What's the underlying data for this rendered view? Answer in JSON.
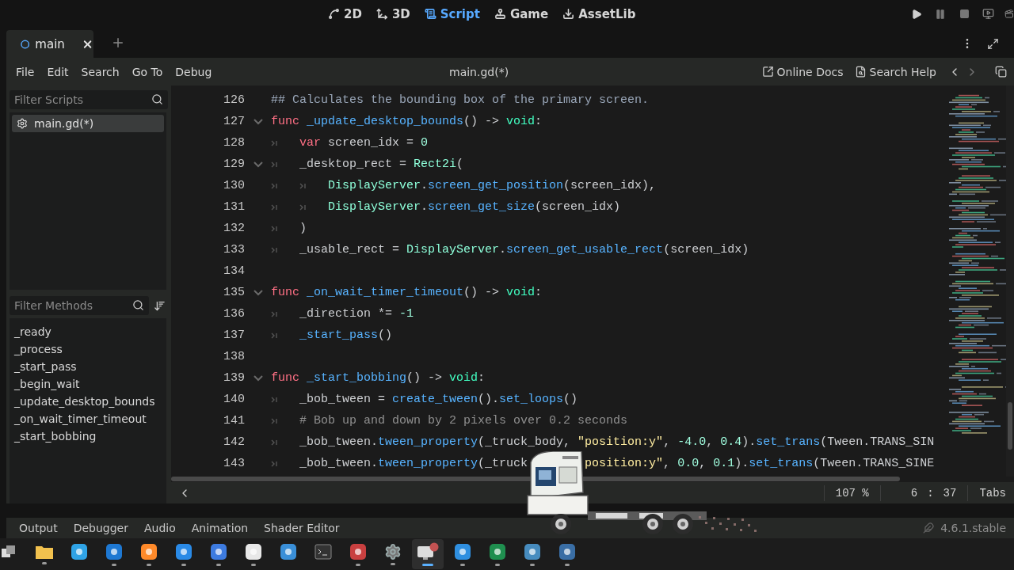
{
  "workspaces": [
    {
      "label": "2D",
      "kind": "planar",
      "selected": false
    },
    {
      "label": "3D",
      "kind": "spatial",
      "selected": false
    },
    {
      "label": "Script",
      "kind": "script",
      "selected": true
    },
    {
      "label": "Game",
      "kind": "game",
      "selected": false
    },
    {
      "label": "AssetLib",
      "kind": "assetlib",
      "selected": false
    }
  ],
  "scene_tabs": [
    {
      "label": "main",
      "selected": true
    }
  ],
  "menu": [
    "File",
    "Edit",
    "Search",
    "Go To",
    "Debug"
  ],
  "file_title": "main.gd(*)",
  "help_links": [
    {
      "label": "Online Docs",
      "kind": "docs"
    },
    {
      "label": "Search Help",
      "kind": "help"
    }
  ],
  "scripts_filter": {
    "placeholder": "Filter Scripts"
  },
  "scripts": [
    {
      "label": "main.gd(*)",
      "selected": true
    }
  ],
  "methods_filter": {
    "placeholder": "Filter Methods"
  },
  "methods": [
    "_ready",
    "_process",
    "_start_pass",
    "_begin_wait",
    "_update_desktop_bounds",
    "_on_wait_timer_timeout",
    "_start_bobbing"
  ],
  "code_lines": [
    {
      "number": "126",
      "foldable": false,
      "tokens": [
        {
          "kind": "doc",
          "text": "## Calculates the bounding box of the primary screen."
        }
      ]
    },
    {
      "number": "127",
      "foldable": true,
      "tokens": [
        {
          "kind": "keyword",
          "text": "func"
        },
        {
          "kind": "function",
          "text": "_update_desktop_bounds"
        },
        {
          "kind": "plain",
          "text": "() -> "
        },
        {
          "kind": "type",
          "text": "void"
        },
        {
          "kind": "plain",
          "text": ":"
        }
      ]
    },
    {
      "number": "128",
      "foldable": false,
      "tokens": [
        {
          "kind": "tab"
        },
        {
          "kind": "keyword",
          "text": "var"
        },
        {
          "kind": "plain",
          "text": "screen_idx = "
        },
        {
          "kind": "number",
          "text": "0"
        }
      ]
    },
    {
      "number": "129",
      "foldable": true,
      "tokens": [
        {
          "kind": "tab"
        },
        {
          "kind": "plain",
          "text": "_desktop_rect = "
        },
        {
          "kind": "class",
          "text": "Rect2i"
        },
        {
          "kind": "plain",
          "text": "("
        }
      ]
    },
    {
      "number": "130",
      "foldable": false,
      "tokens": [
        {
          "kind": "tab"
        },
        {
          "kind": "tab"
        },
        {
          "kind": "class",
          "text": "DisplayServer"
        },
        {
          "kind": "plain",
          "text": "."
        },
        {
          "kind": "function",
          "text": "screen_get_position"
        },
        {
          "kind": "plain",
          "text": "(screen_idx),"
        }
      ]
    },
    {
      "number": "131",
      "foldable": false,
      "tokens": [
        {
          "kind": "tab"
        },
        {
          "kind": "tab"
        },
        {
          "kind": "class",
          "text": "DisplayServer"
        },
        {
          "kind": "plain",
          "text": "."
        },
        {
          "kind": "function",
          "text": "screen_get_size"
        },
        {
          "kind": "plain",
          "text": "(screen_idx)"
        }
      ]
    },
    {
      "number": "132",
      "foldable": false,
      "tokens": [
        {
          "kind": "tab"
        },
        {
          "kind": "plain",
          "text": ")"
        }
      ]
    },
    {
      "number": "133",
      "foldable": false,
      "tokens": [
        {
          "kind": "tab"
        },
        {
          "kind": "plain",
          "text": "_usable_rect = "
        },
        {
          "kind": "class",
          "text": "DisplayServer"
        },
        {
          "kind": "plain",
          "text": "."
        },
        {
          "kind": "function",
          "text": "screen_get_usable_rect"
        },
        {
          "kind": "plain",
          "text": "(screen_idx)"
        }
      ]
    },
    {
      "number": "134",
      "foldable": false
    },
    {
      "number": "135",
      "foldable": true,
      "tokens": [
        {
          "kind": "keyword",
          "text": "func"
        },
        {
          "kind": "function",
          "text": "_on_wait_timer_timeout"
        },
        {
          "kind": "plain",
          "text": "() -> "
        },
        {
          "kind": "type",
          "text": "void"
        },
        {
          "kind": "plain",
          "text": ":"
        }
      ]
    },
    {
      "number": "136",
      "foldable": false,
      "tokens": [
        {
          "kind": "tab"
        },
        {
          "kind": "plain",
          "text": "_direction *= "
        },
        {
          "kind": "number",
          "text": "-1"
        }
      ]
    },
    {
      "number": "137",
      "foldable": false,
      "tokens": [
        {
          "kind": "tab"
        },
        {
          "kind": "function",
          "text": "_start_pass"
        },
        {
          "kind": "plain",
          "text": "()"
        }
      ]
    },
    {
      "number": "138",
      "foldable": false
    },
    {
      "number": "139",
      "foldable": true,
      "tokens": [
        {
          "kind": "keyword",
          "text": "func"
        },
        {
          "kind": "function",
          "text": "_start_bobbing"
        },
        {
          "kind": "plain",
          "text": "() -> "
        },
        {
          "kind": "type",
          "text": "void"
        },
        {
          "kind": "plain",
          "text": ":"
        }
      ]
    },
    {
      "number": "140",
      "foldable": false,
      "tokens": [
        {
          "kind": "tab"
        },
        {
          "kind": "plain",
          "text": "_bob_tween = "
        },
        {
          "kind": "function",
          "text": "create_tween"
        },
        {
          "kind": "plain",
          "text": "()."
        },
        {
          "kind": "function",
          "text": "set_loops"
        },
        {
          "kind": "plain",
          "text": "()"
        }
      ]
    },
    {
      "number": "141",
      "foldable": false,
      "tokens": [
        {
          "kind": "tab"
        },
        {
          "kind": "comment",
          "text": "# Bob up and down by 2 pixels over 0.2 seconds"
        }
      ]
    },
    {
      "number": "142",
      "foldable": false,
      "tokens": [
        {
          "kind": "tab"
        },
        {
          "kind": "plain",
          "text": "_bob_tween."
        },
        {
          "kind": "function",
          "text": "tween_property"
        },
        {
          "kind": "plain",
          "text": "(_truck_body, "
        },
        {
          "kind": "string",
          "text": "\"position:y\""
        },
        {
          "kind": "plain",
          "text": ", "
        },
        {
          "kind": "number",
          "text": "-4.0"
        },
        {
          "kind": "plain",
          "text": ", "
        },
        {
          "kind": "number",
          "text": "0.4"
        },
        {
          "kind": "plain",
          "text": ")."
        },
        {
          "kind": "function",
          "text": "set_trans"
        },
        {
          "kind": "plain",
          "text": "(Tween.TRANS_SIN"
        }
      ]
    },
    {
      "number": "143",
      "foldable": false,
      "tokens": [
        {
          "kind": "tab"
        },
        {
          "kind": "plain",
          "text": "_bob_tween."
        },
        {
          "kind": "function",
          "text": "tween_property"
        },
        {
          "kind": "plain",
          "text": "(_truck"
        },
        {
          "kind": "covered"
        },
        {
          "kind": "string",
          "text": "position:y\""
        },
        {
          "kind": "plain",
          "text": ", "
        },
        {
          "kind": "number",
          "text": "0.0"
        },
        {
          "kind": "plain",
          "text": ", "
        },
        {
          "kind": "number",
          "text": "0.1"
        },
        {
          "kind": "plain",
          "text": ")."
        },
        {
          "kind": "function",
          "text": "set_trans"
        },
        {
          "kind": "plain",
          "text": "(Tween.TRANS_SINE"
        }
      ]
    }
  ],
  "status": {
    "zoom": "107 %",
    "line": "6",
    "separator": ":",
    "column": "37",
    "indent_mode": "Tabs"
  },
  "bottom_tabs": [
    "Output",
    "Debugger",
    "Audio",
    "Animation",
    "Shader Editor"
  ],
  "version": "4.6.1.stable",
  "taskbar": [
    {
      "running": false,
      "selected": false
    },
    {
      "running": true,
      "selected": false
    },
    {
      "running": false,
      "selected": false
    },
    {
      "running": true,
      "selected": false
    },
    {
      "running": true,
      "selected": false
    },
    {
      "running": true,
      "selected": false
    },
    {
      "running": true,
      "selected": false
    },
    {
      "running": true,
      "selected": false
    },
    {
      "running": false,
      "selected": false
    },
    {
      "running": false,
      "selected": false
    },
    {
      "running": true,
      "selected": false
    },
    {
      "running": true,
      "selected": false
    },
    {
      "running": true,
      "selected": true
    },
    {
      "running": true,
      "selected": false
    },
    {
      "running": true,
      "selected": false
    },
    {
      "running": true,
      "selected": false
    },
    {
      "running": true,
      "selected": false
    }
  ]
}
